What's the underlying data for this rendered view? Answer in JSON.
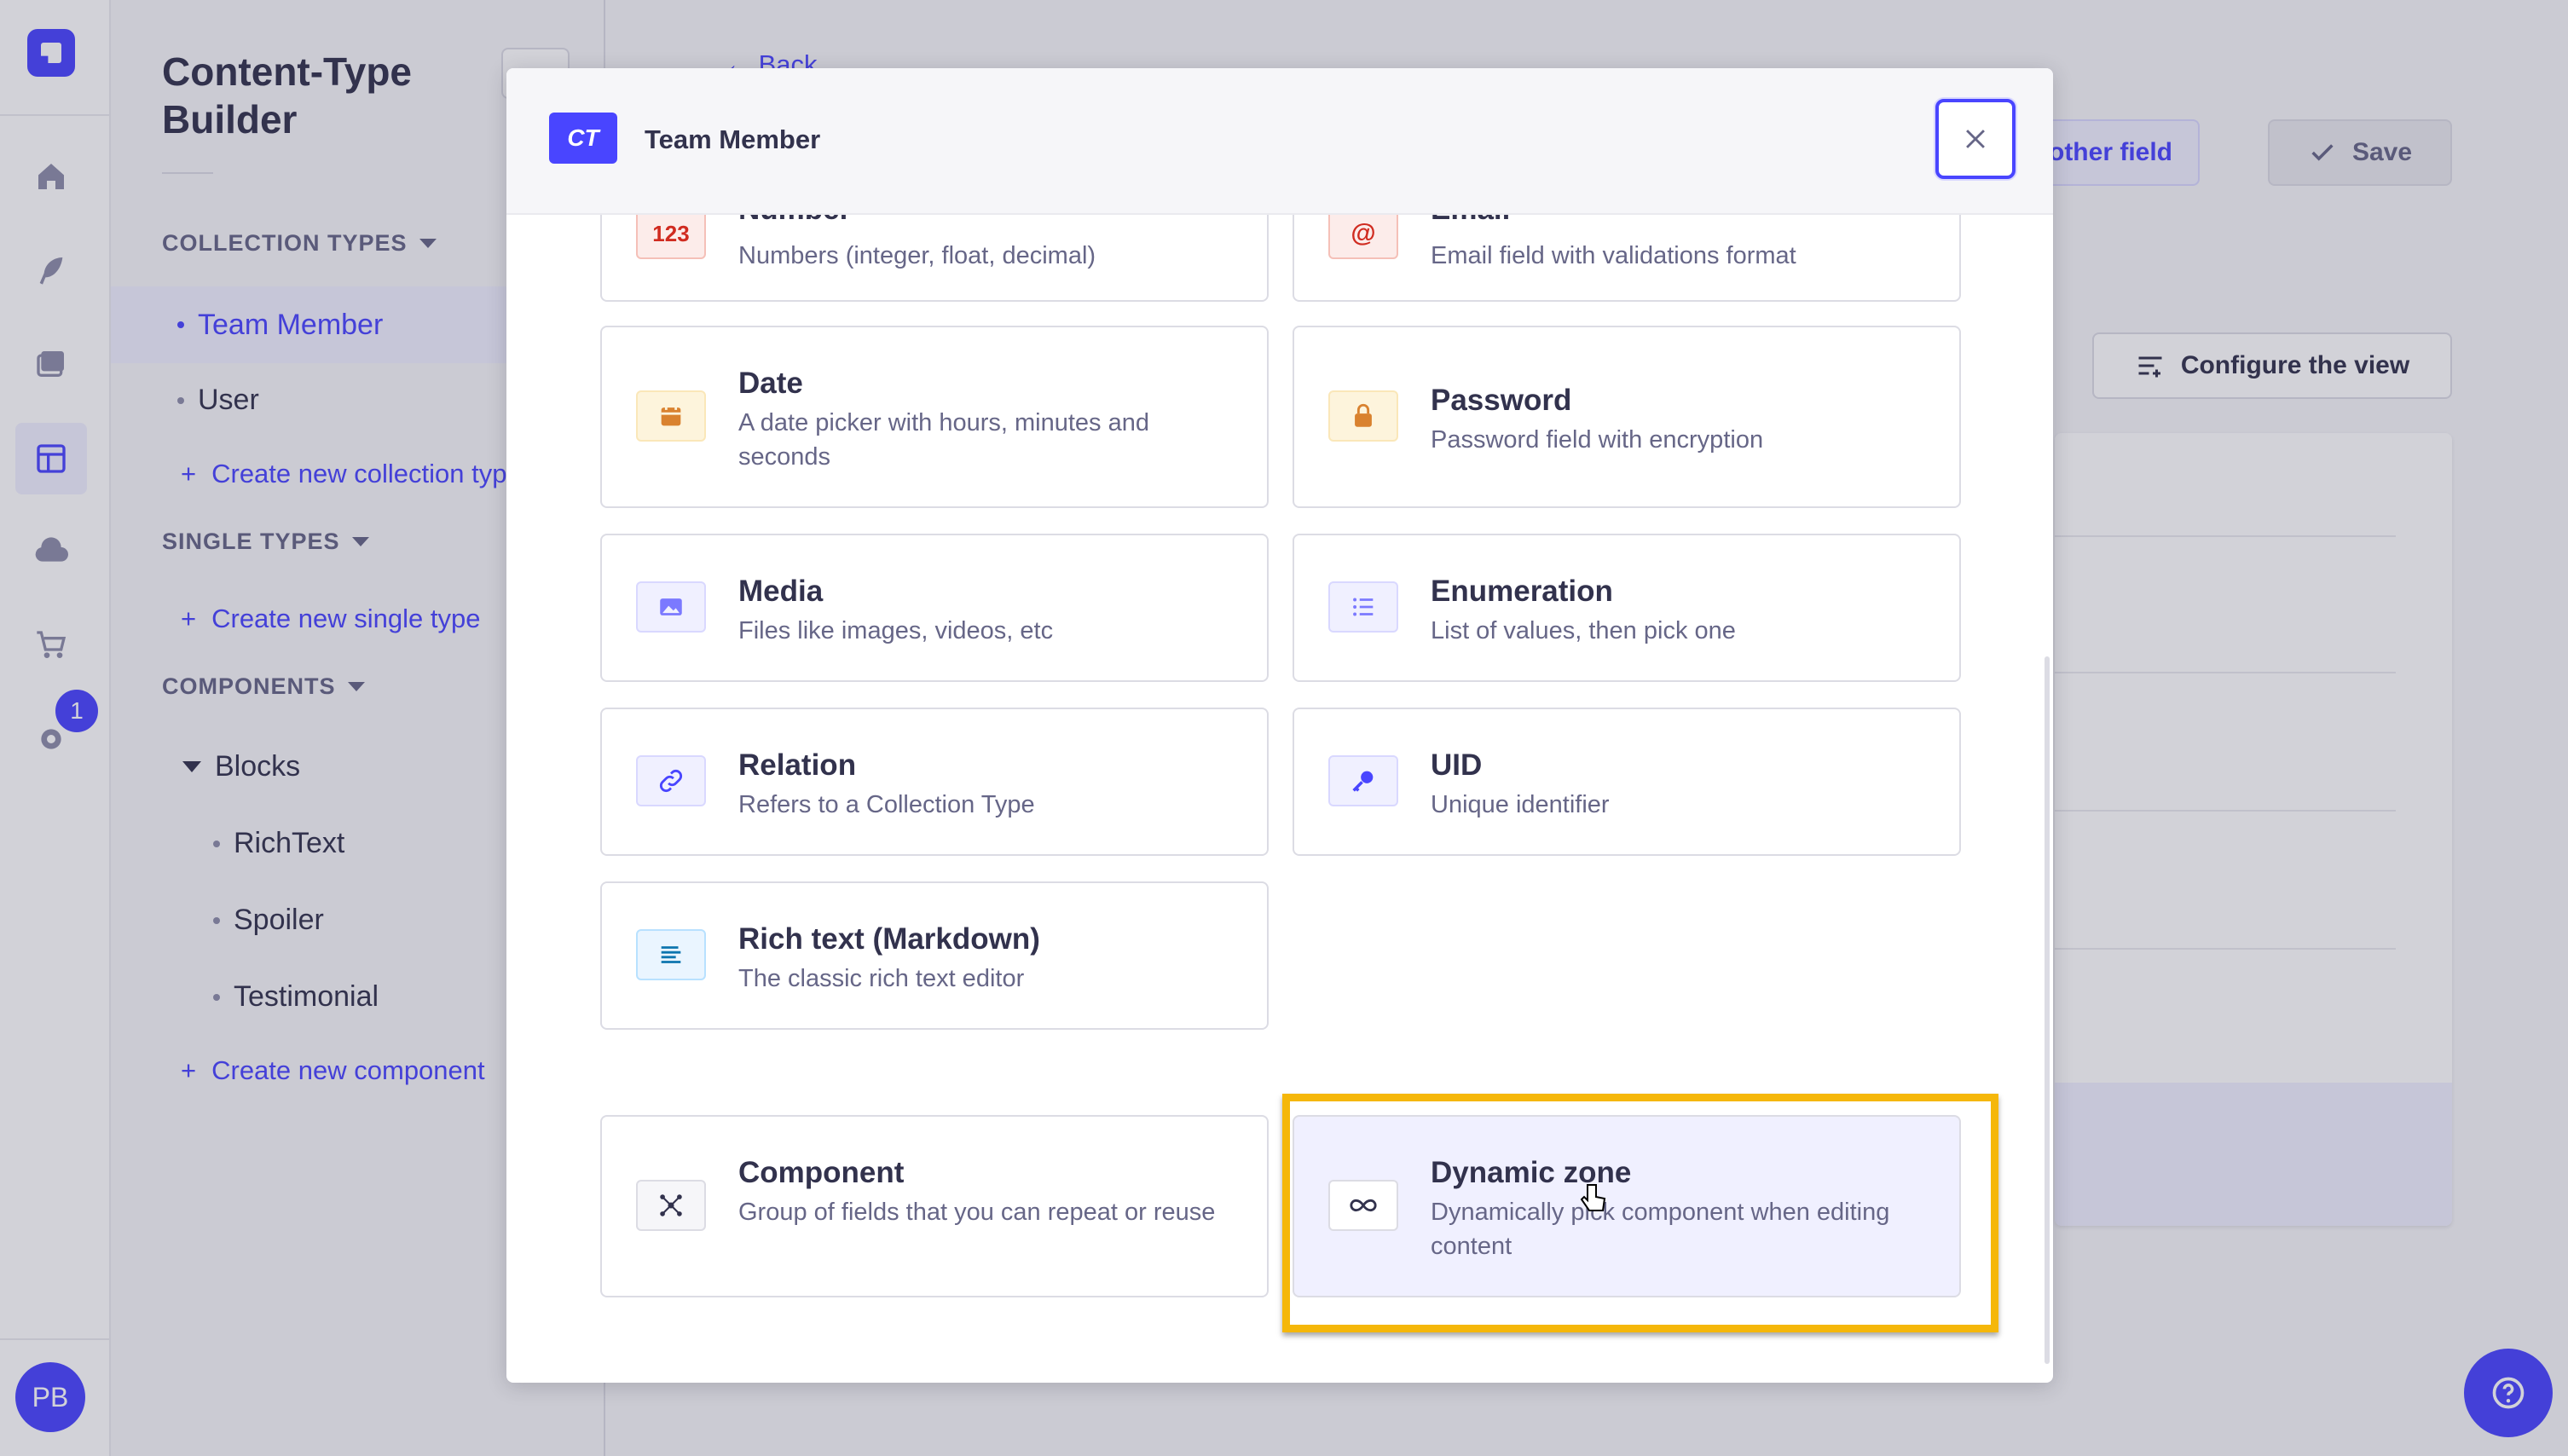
{
  "app": {
    "colors": {
      "primary": "#4945ff",
      "highlight": "#f5b70a",
      "text": "#32324d",
      "muted": "#666687"
    }
  },
  "rail": {
    "icons": [
      "home-icon",
      "feather-icon",
      "media-icon",
      "layout-icon",
      "cloud-icon",
      "cart-icon",
      "gear-icon"
    ],
    "badge_count": "1",
    "avatar_initials": "PB"
  },
  "sidebar": {
    "title": "Content-Type Builder",
    "collection_types_header": "COLLECTION TYPES",
    "collection_types": [
      "Team Member",
      "User"
    ],
    "create_collection_link": "Create new collection type",
    "single_types_header": "SINGLE TYPES",
    "create_single_link": "Create new single type",
    "components_header": "COMPONENTS",
    "component_category": "Blocks",
    "components": [
      "RichText",
      "Spoiler",
      "Testimonial"
    ],
    "create_component_link": "Create new component"
  },
  "main": {
    "back_label": "Back",
    "add_another_field_label": "another field",
    "save_label": "Save",
    "configure_view_label": "Configure the view"
  },
  "modal": {
    "badge": "CT",
    "title": "Team Member",
    "fields": [
      {
        "title": "Number",
        "description": "Numbers (integer, float, decimal)",
        "icon": "number-icon",
        "icon_text": "123"
      },
      {
        "title": "Email",
        "description": "Email field with validations format",
        "icon": "at-icon"
      },
      {
        "title": "Date",
        "description": "A date picker with hours, minutes and seconds",
        "icon": "calendar-icon"
      },
      {
        "title": "Password",
        "description": "Password field with encryption",
        "icon": "lock-icon"
      },
      {
        "title": "Media",
        "description": "Files like images, videos, etc",
        "icon": "image-icon"
      },
      {
        "title": "Enumeration",
        "description": "List of values, then pick one",
        "icon": "list-icon"
      },
      {
        "title": "Relation",
        "description": "Refers to a Collection Type",
        "icon": "link-icon"
      },
      {
        "title": "UID",
        "description": "Unique identifier",
        "icon": "key-icon"
      },
      {
        "title": "Rich text (Markdown)",
        "description": "The classic rich text editor",
        "icon": "text-align-icon"
      },
      {
        "title": "Component",
        "description": "Group of fields that you can repeat or reuse",
        "icon": "component-icon"
      },
      {
        "title": "Dynamic zone",
        "description": "Dynamically pick component when editing content",
        "icon": "infinity-icon"
      }
    ]
  }
}
